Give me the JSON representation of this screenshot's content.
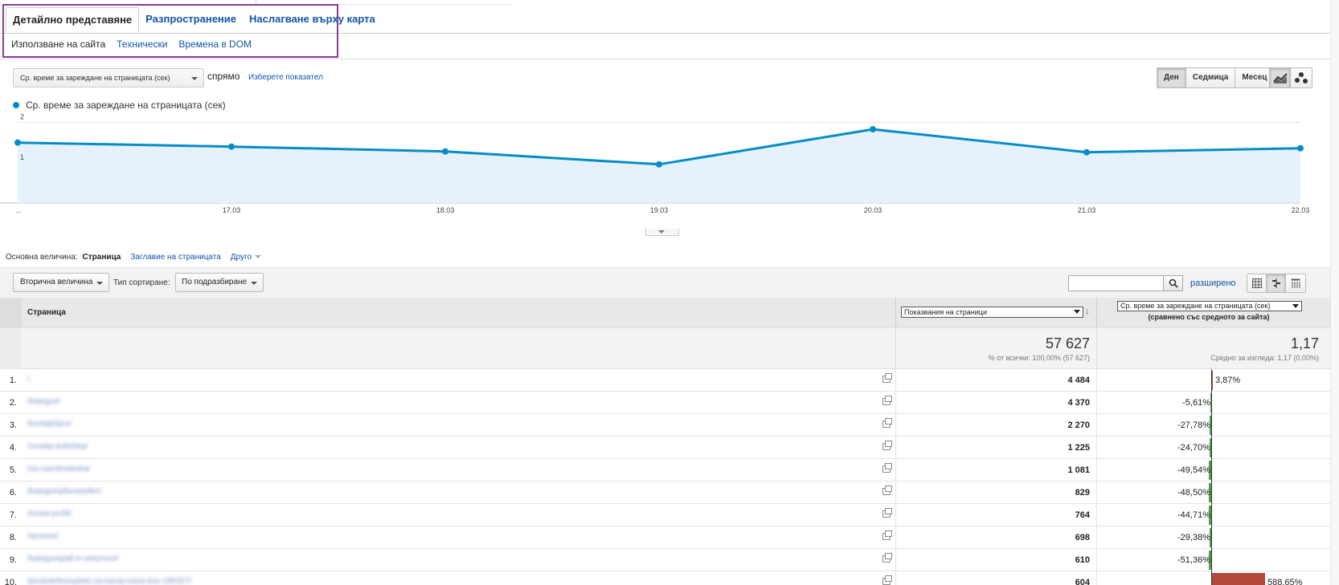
{
  "tabs": [
    "Детайлно представяне",
    "Разпространение",
    "Наслагване върху карта"
  ],
  "subtabs": [
    "Използване на сайта",
    "Технически",
    "Времена в DOM"
  ],
  "metric": {
    "selected": "Ср. време за зареждане на страницата (сек)",
    "vs_label": "спрямо",
    "choose_metric": "Изберете показател"
  },
  "period_buttons": [
    "Ден",
    "Седмица",
    "Месец"
  ],
  "legend": "Ср. време за зареждане на страницата (сек)",
  "chart_data": {
    "type": "area",
    "x": [
      "...",
      "17.03",
      "18.03",
      "19.03",
      "20.03",
      "21.03",
      "22.03"
    ],
    "series": [
      {
        "name": "Ср. време за зареждане на страницата (сек)",
        "values": [
          1.5,
          1.4,
          1.28,
          0.96,
          1.83,
          1.26,
          1.36
        ]
      }
    ],
    "y_ticks": [
      "2",
      "1"
    ],
    "ylim": [
      0,
      2.25
    ],
    "color": "#058dc7",
    "fill": "#e5f1fb"
  },
  "dimension": {
    "label": "Основна величина:",
    "active": "Страница",
    "page_title": "Заглавие на страницата",
    "other": "Друго"
  },
  "toolbar": {
    "secondary": "Вторична величина",
    "sort_label": "Тип сортиране:",
    "sort_value": "По подразбиране",
    "search_placeholder": "",
    "advanced": "разширено"
  },
  "table": {
    "col_page": "Страница",
    "col_pageviews": "Показвания на страници",
    "col_loadtime": "Ср. време за зареждане на страницата (сек)",
    "col_loadtime_sub": "(сравнено със средното за сайта)",
    "total_pageviews": "57 627",
    "total_pageviews_sub": "% от всички: 100,00% (57 627)",
    "total_loadtime": "1,17",
    "total_loadtime_sub": "Средно за изгледа: 1,17 (0,00%)",
    "rows": [
      {
        "idx": "1.",
        "page": "/",
        "pageviews": "4 484",
        "delta": "3,87%",
        "delta_value": 3.87
      },
      {
        "idx": "2.",
        "page": "/kategori/",
        "pageviews": "4 370",
        "delta": "-5,61%",
        "delta_value": -5.61
      },
      {
        "idx": "3.",
        "page": "/kontakt/pro/",
        "pageviews": "2 270",
        "delta": "-27,78%",
        "delta_value": -27.78
      },
      {
        "idx": "4.",
        "page": "/moiata-kolichka/",
        "pageviews": "1 225",
        "delta": "-24,70%",
        "delta_value": -24.7
      },
      {
        "idx": "5.",
        "page": "/za-nas/dostavka/",
        "pageviews": "1 081",
        "delta": "-49,54%",
        "delta_value": -49.54
      },
      {
        "idx": "6.",
        "page": "/kategoriq/bestseller/",
        "pageviews": "829",
        "delta": "-48,50%",
        "delta_value": -48.5
      },
      {
        "idx": "7.",
        "page": "/moiat-profil/",
        "pageviews": "764",
        "delta": "-44,71%",
        "delta_value": -44.71
      },
      {
        "idx": "8.",
        "page": "/tarsene/",
        "pageviews": "698",
        "delta": "-29,38%",
        "delta_value": -29.38
      },
      {
        "idx": "9.",
        "page": "/kategoriq/all-in-sets/novi/",
        "pageviews": "610",
        "delta": "-51,36%",
        "delta_value": -51.36
      },
      {
        "idx": "10.",
        "page": "/produkt/komplekt-za-baniq-extra-line-185327/",
        "pageviews": "604",
        "delta": "588,65%",
        "delta_value": 588.65
      }
    ]
  }
}
